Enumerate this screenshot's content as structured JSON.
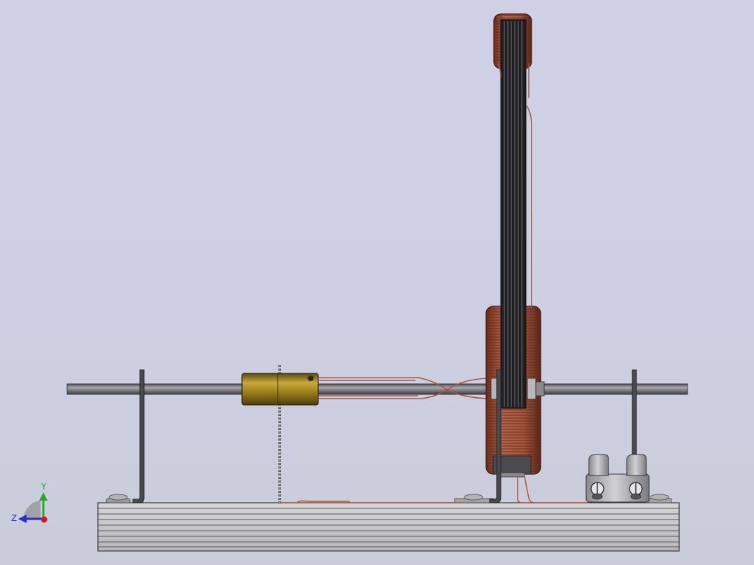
{
  "axes": {
    "y_label": "Y",
    "z_label": "Z",
    "colors": {
      "y": "#1fae2a",
      "z": "#1f2fd0",
      "x": "#e01020"
    }
  },
  "materials": {
    "steel": "#6e6e72",
    "brass": "#a88a1e",
    "copper": "#a8553a",
    "core": "#2c2c2c",
    "base": "#c9c9cc"
  }
}
